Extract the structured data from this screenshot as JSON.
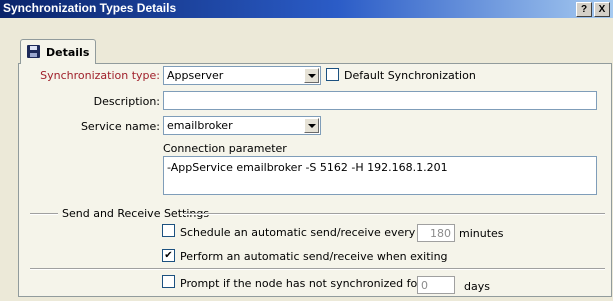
{
  "window": {
    "title": "Synchronization Types Details",
    "help_glyph": "?",
    "close_glyph": "X"
  },
  "tabs": [
    {
      "label": "Details",
      "icon": "disk-icon"
    }
  ],
  "form": {
    "sync_type_label": "Synchronization type:",
    "sync_type_value": "Appserver",
    "default_sync_label": "Default Synchronization",
    "default_sync_checked": false,
    "description_label": "Description:",
    "description_value": "",
    "service_label": "Service name:",
    "service_value": "emailbroker",
    "conn_label": "Connection parameter",
    "conn_value": "-AppService emailbroker -S 5162 -H 192.168.1.201"
  },
  "send_receive": {
    "group_label": "Send and Receive Settings",
    "schedule_label": "Schedule an automatic send/receive every",
    "schedule_checked": false,
    "schedule_minutes": "180",
    "minutes_unit": "minutes",
    "exit_label": "Perform an automatic send/receive when exiting",
    "exit_checked": true,
    "prompt_label": "Prompt if the node has not synchronized for",
    "prompt_checked": false,
    "prompt_days": "0",
    "days_unit": "days"
  },
  "colors": {
    "title_gradient_start": "#0a246a",
    "title_gradient_end": "#a6caf0",
    "required_label": "#a0202b",
    "dialog_bg": "#ece9d8"
  }
}
